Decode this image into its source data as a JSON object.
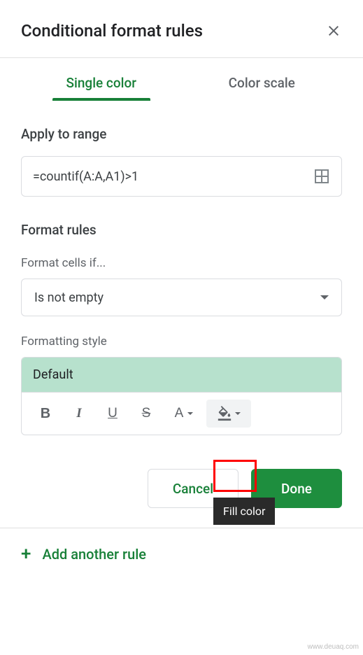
{
  "header": {
    "title": "Conditional format rules"
  },
  "tabs": {
    "single_color": "Single color",
    "color_scale": "Color scale"
  },
  "range": {
    "label": "Apply to range",
    "value": "=countif(A:A,A1)>1"
  },
  "rules": {
    "label": "Format rules",
    "cells_if_label": "Format cells if...",
    "condition": "Is not empty"
  },
  "style": {
    "label": "Formatting style",
    "preview": "Default",
    "toolbar": {
      "bold": "B",
      "italic": "I",
      "underline": "U",
      "strike": "S",
      "textcolor": "A"
    }
  },
  "tooltip": {
    "fill_color": "Fill color"
  },
  "actions": {
    "cancel": "Cancel",
    "done": "Done"
  },
  "footer": {
    "add_rule": "Add another rule"
  },
  "watermark": "www.deuaq.com"
}
